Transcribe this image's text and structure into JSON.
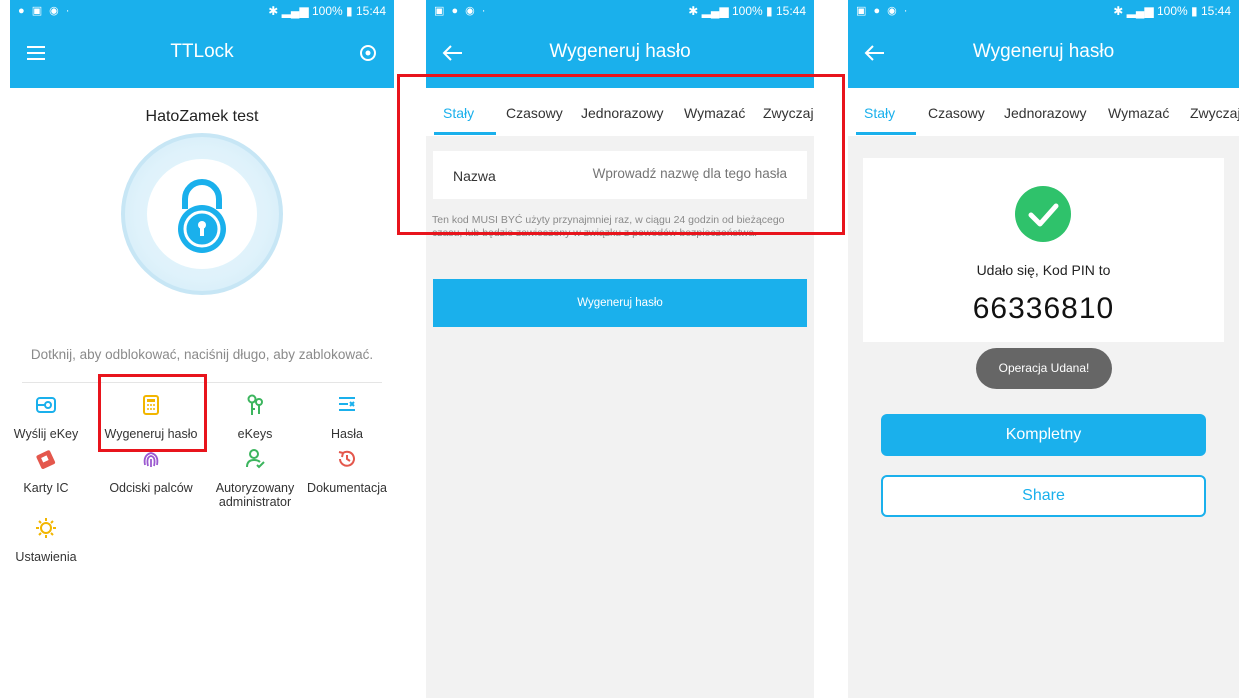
{
  "statusbar": {
    "battery": "100%",
    "time": "15:44"
  },
  "panel1": {
    "title": "TTLock",
    "lock_name": "HatoZamek test",
    "hint": "Dotknij, aby odblokować, naciśnij długo, aby zablokować.",
    "grid": [
      {
        "label": "Wyślij eKey",
        "icon": "send-ekey-icon"
      },
      {
        "label": "Wygeneruj hasło",
        "icon": "keypad-icon"
      },
      {
        "label": "eKeys",
        "icon": "keys-icon"
      },
      {
        "label": "Hasła",
        "icon": "password-list-icon"
      },
      {
        "label": "Karty IC",
        "icon": "ic-card-icon"
      },
      {
        "label": "Odciski palców",
        "icon": "fingerprint-icon"
      },
      {
        "label": "Autoryzowany administrator",
        "icon": "admin-icon"
      },
      {
        "label": "Dokumentacja",
        "icon": "history-icon"
      },
      {
        "label": "Ustawienia",
        "icon": "settings-icon"
      }
    ]
  },
  "panel2": {
    "title": "Wygeneruj hasło",
    "tabs": [
      "Stały",
      "Czasowy",
      "Jednorazowy",
      "Wymazać",
      "Zwyczaj"
    ],
    "field_label": "Nazwa",
    "field_placeholder": "Wprowadź nazwę dla tego hasła",
    "note": "Ten kod MUSI BYĆ użyty przynajmniej raz, w ciągu 24 godzin od bieżącego czasu, lub będzie zawieszony w związku z powodów bezpieczeństwa.",
    "button": "Wygeneruj hasło"
  },
  "panel3": {
    "title": "Wygeneruj hasło",
    "tabs": [
      "Stały",
      "Czasowy",
      "Jednorazowy",
      "Wymazać",
      "Zwyczaj"
    ],
    "success": "Udało się, Kod PIN to",
    "pin": "66336810",
    "toast": "Operacja Udana!",
    "complete": "Kompletny",
    "share": "Share"
  },
  "colors": {
    "primary": "#1ab0ec",
    "highlight": "#e8141c",
    "success": "#2fc26b"
  }
}
